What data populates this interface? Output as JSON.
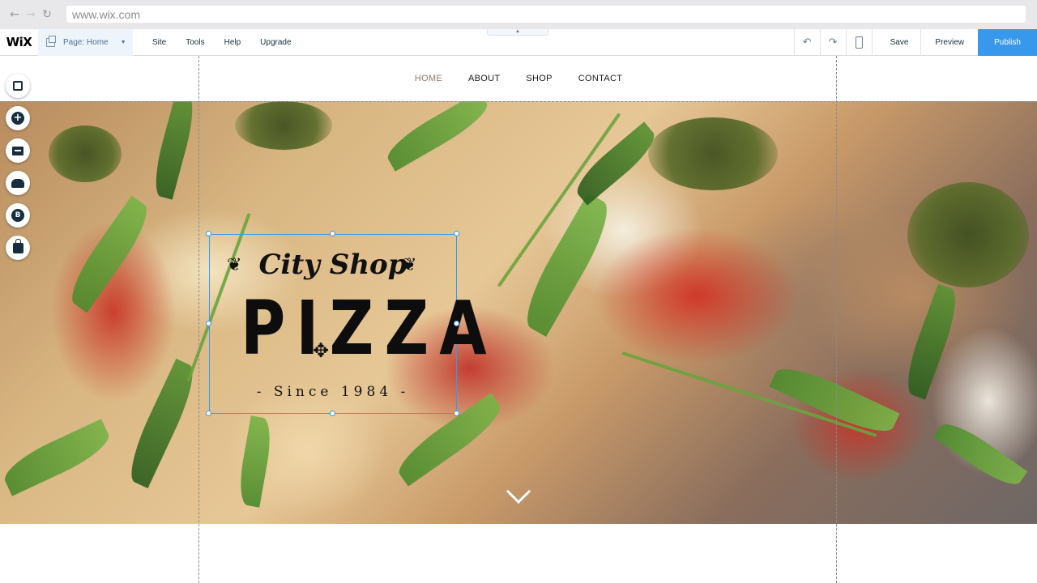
{
  "browser": {
    "back_icon": "arrow-left-icon",
    "forward_icon": "arrow-right-icon",
    "reload_icon": "reload-icon",
    "url": "www.wix.com"
  },
  "editor": {
    "logo": "WiX",
    "page_selector": "Page: Home",
    "menu": [
      "Site",
      "Tools",
      "Help",
      "Upgrade"
    ],
    "collapse_icon": "chevron-up-icon",
    "undo_icon": "undo-icon",
    "redo_icon": "redo-icon",
    "mobile_icon": "mobile-icon",
    "save": "Save",
    "preview": "Preview",
    "publish": "Publish",
    "publish_color": "#3899ec"
  },
  "site": {
    "nav": [
      "HOME",
      "ABOUT",
      "SHOP",
      "CONTACT"
    ],
    "active_nav": "HOME",
    "logo_script": "City Shop",
    "logo_main": "PIZZA",
    "logo_sub": "- Since 1984 -",
    "scroll_icon": "chevron-down-icon"
  },
  "left_toolbar": [
    "background-icon",
    "add-icon",
    "media-icon",
    "upload-icon",
    "blog-icon",
    "store-icon"
  ]
}
